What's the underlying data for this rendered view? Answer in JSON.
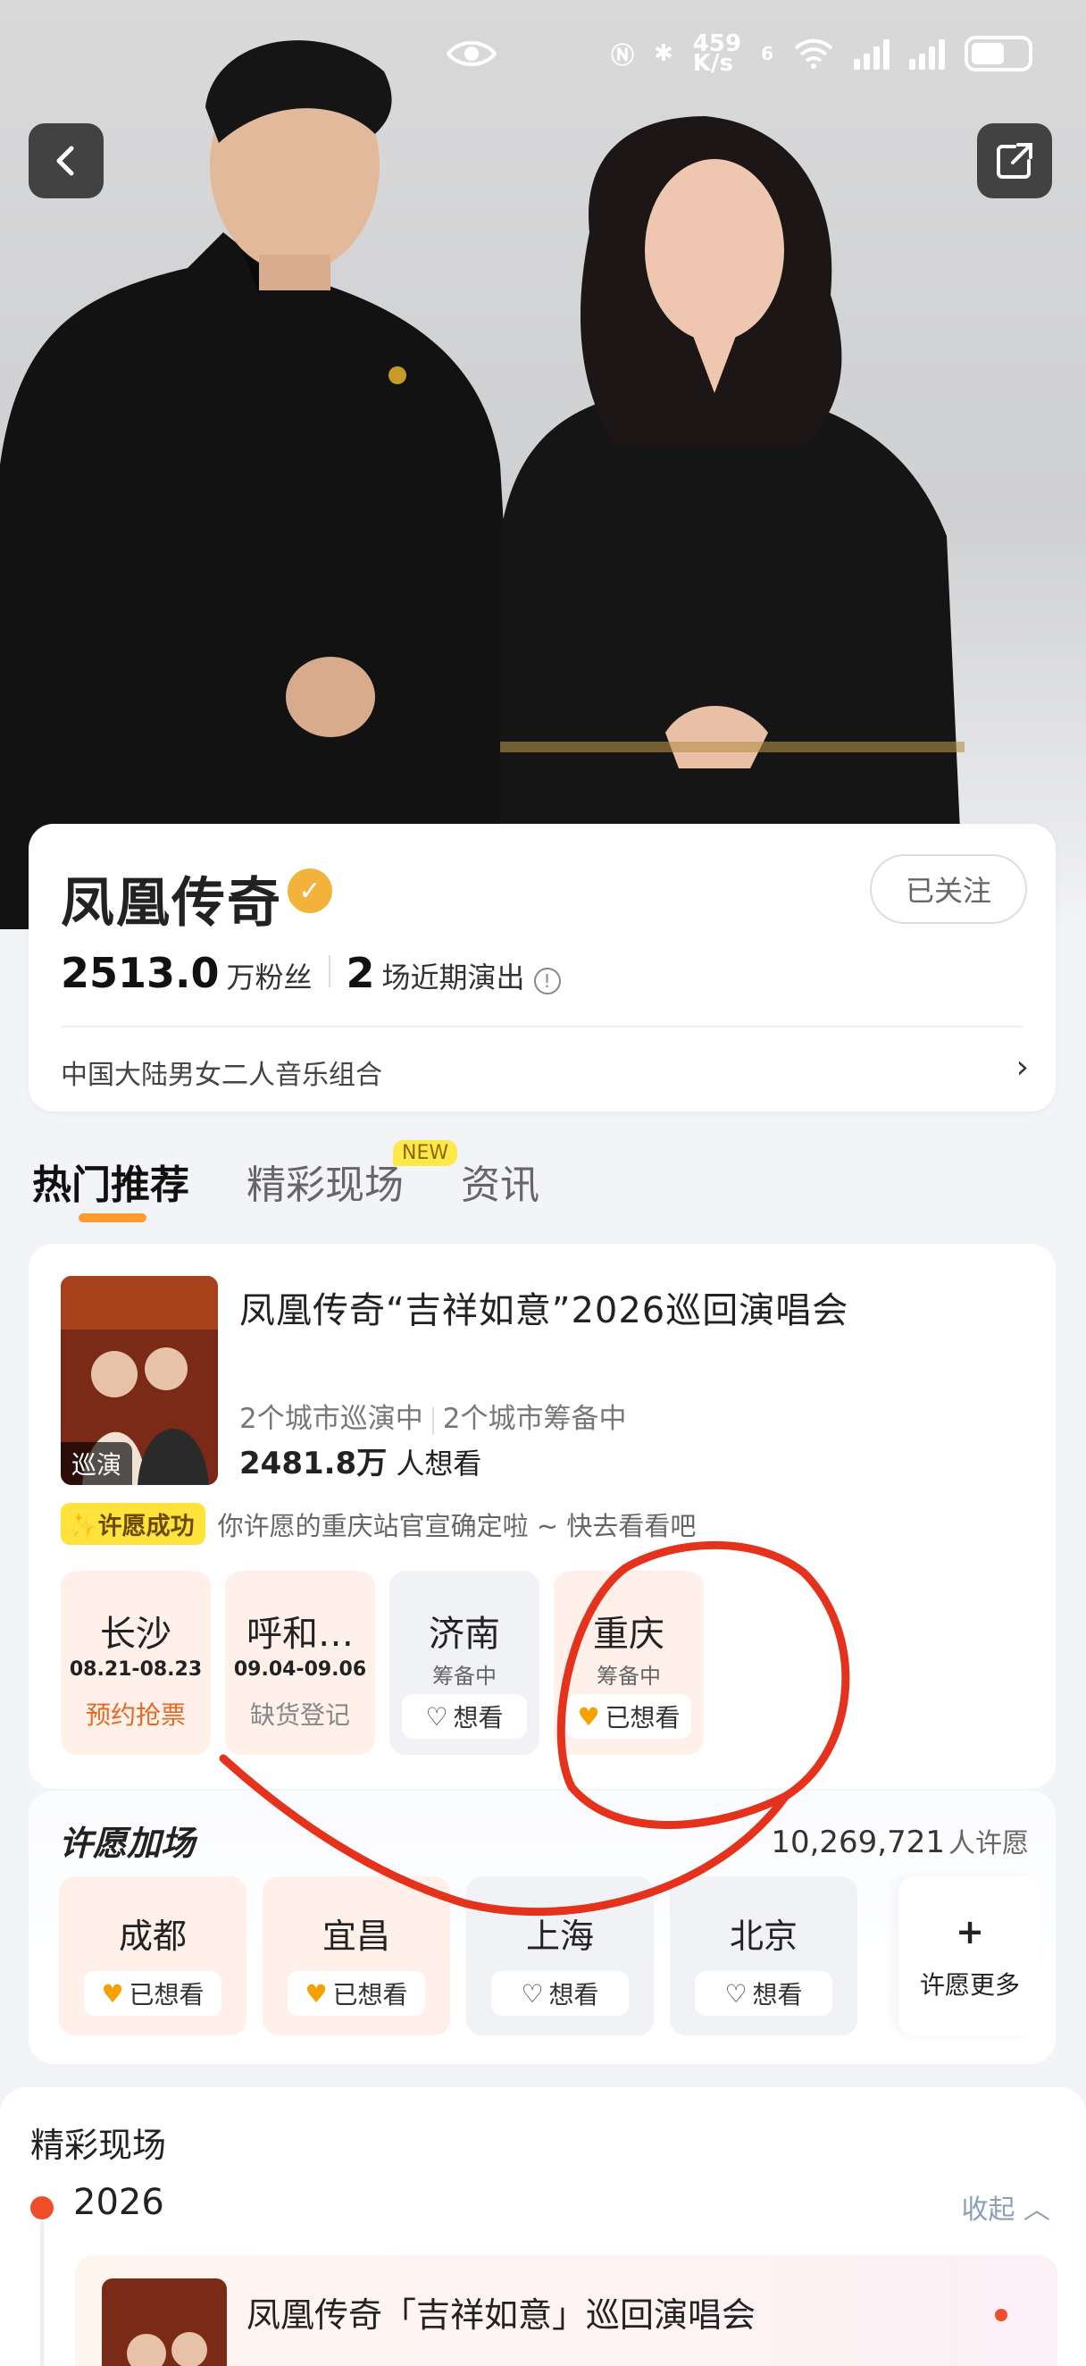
{
  "statusbar": {
    "net_speed_value": "459",
    "net_speed_unit": "K/s",
    "signal_label": "6"
  },
  "artist": {
    "name": "凤凰传奇",
    "follow_label": "已关注",
    "fans_number": "2513.0",
    "fans_unit": "万粉丝",
    "shows_number": "2",
    "shows_unit": "场近期演出",
    "description": "中国大陆男女二人音乐组合"
  },
  "tabs": [
    {
      "label": "热门推荐",
      "active": true
    },
    {
      "label": "精彩现场",
      "badge": "NEW"
    },
    {
      "label": "资讯"
    }
  ],
  "tour": {
    "poster_tag": "巡演",
    "title": "凤凰传奇“吉祥如意”2026巡回演唱会",
    "touring": "2个城市巡演中",
    "preparing": "2个城市筹备中",
    "want_number": "2481.8万",
    "want_unit": "人想看",
    "wish_badge": "许愿成功",
    "wish_text": "你许愿的重庆站官宣确定啦 ~ 快去看看吧",
    "cities": [
      {
        "name": "长沙",
        "date": "08.21-08.23",
        "action": "预约抢票"
      },
      {
        "name": "呼和…",
        "date": "09.04-09.06",
        "action": "缺货登记"
      },
      {
        "name": "济南",
        "status": "筹备中",
        "want": "想看"
      },
      {
        "name": "重庆",
        "status": "筹备中",
        "want": "已想看"
      }
    ]
  },
  "wish_add": {
    "title": "许愿加场",
    "count": "10,269,721",
    "count_unit": "人许愿",
    "cities": [
      {
        "name": "成都",
        "want": "已想看"
      },
      {
        "name": "宜昌",
        "want": "已想看"
      },
      {
        "name": "上海",
        "want": "想看"
      },
      {
        "name": "北京",
        "want": "想看"
      }
    ],
    "more_plus": "+",
    "more_label": "许愿更多"
  },
  "live": {
    "title": "精彩现场",
    "year": "2026",
    "collapse": "收起",
    "item_title": "凤凰传奇「吉祥如意」巡回演唱会"
  },
  "colors": {
    "accent": "#ff9a2e",
    "wish_yellow": "#ffe23b",
    "annotation_red": "#e4321c"
  }
}
